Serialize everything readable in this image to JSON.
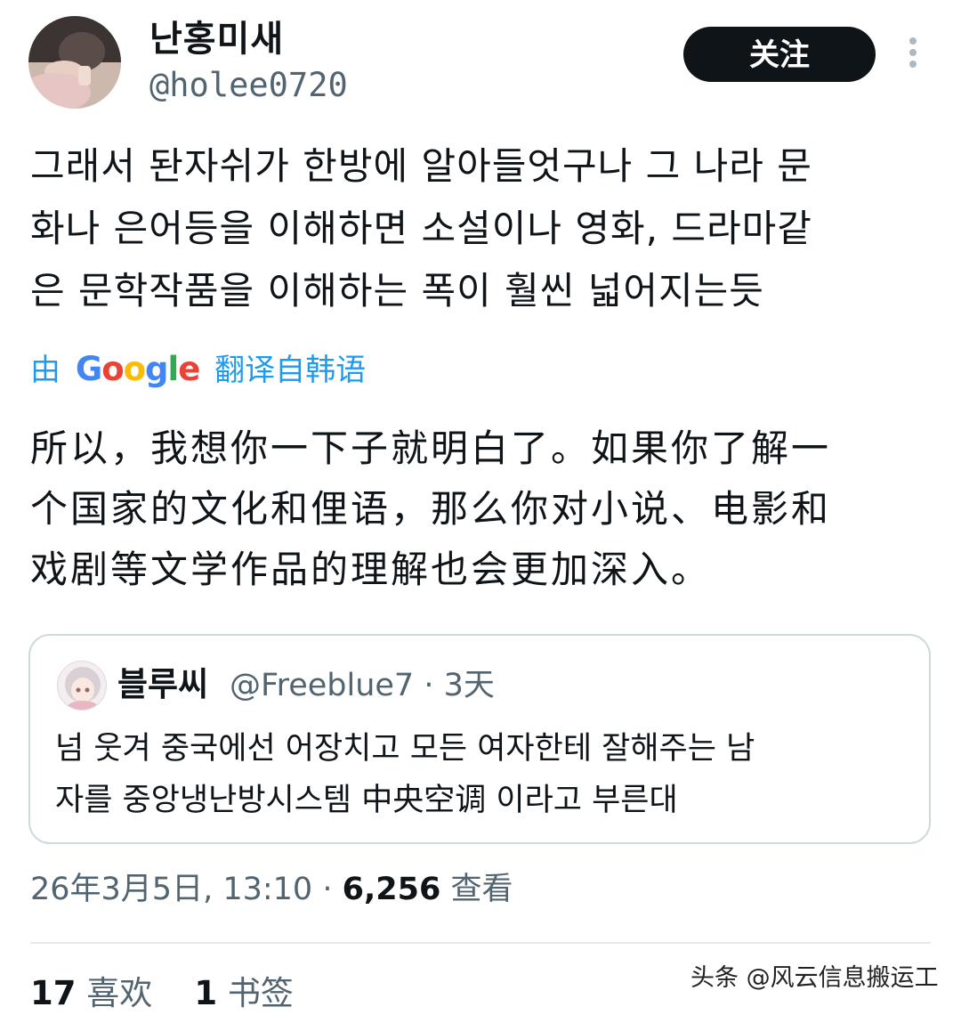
{
  "tweet": {
    "author": {
      "display_name": "난홍미새",
      "handle": "@holee0720"
    },
    "follow_button_label": "关注",
    "text_lines": [
      "그래서 돤자쉬가 한방에 알아들엇구나 그 나라 문",
      "화나 은어등을 이해하면 소설이나 영화, 드라마같",
      "은 문학작품을 이해하는 폭이 훨씬 넓어지는듯"
    ],
    "translation": {
      "prefix": "由",
      "google": "Google",
      "suffix": "翻译自韩语",
      "text_lines": [
        "所以，我想你一下子就明白了。如果你了解一",
        "个国家的文化和俚语，那么你对小说、电影和",
        "戏剧等文学作品的理解也会更加深入。"
      ]
    },
    "quote": {
      "display_name": "블루씨",
      "handle": "@Freeblue7",
      "separator": "·",
      "time": "3天",
      "text_lines": [
        "넘 웃겨 중국에선 어장치고 모든 여자한테 잘해주는 남",
        "자를 중앙냉난방시스템 中央空调 이라고 부른대"
      ]
    },
    "meta": {
      "timestamp": "26年3月5日, 13:10",
      "separator": "·",
      "views_count": "6,256",
      "views_label": "查看"
    },
    "stats": {
      "likes_count": "17",
      "likes_label": "喜欢",
      "bookmarks_count": "1",
      "bookmarks_label": "书签"
    }
  },
  "watermark": "头条 @风云信息搬运工",
  "icons": {
    "more": "more-vertical-icon"
  }
}
